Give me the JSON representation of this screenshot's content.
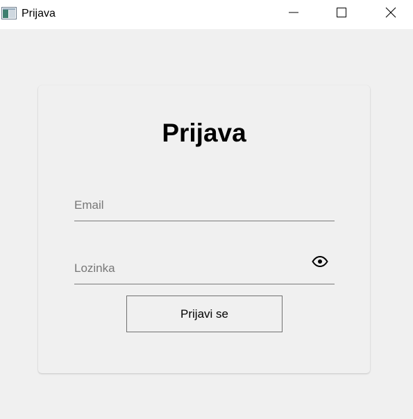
{
  "window": {
    "title": "Prijava",
    "icons": {
      "app": "app-icon",
      "minimize": "minimize-icon",
      "maximize": "maximize-icon",
      "close": "close-icon"
    }
  },
  "form": {
    "heading": "Prijava",
    "email": {
      "value": "",
      "placeholder": "Email"
    },
    "password": {
      "value": "",
      "placeholder": "Lozinka",
      "toggle_icon": "eye-icon"
    },
    "submit_label": "Prijavi se"
  }
}
